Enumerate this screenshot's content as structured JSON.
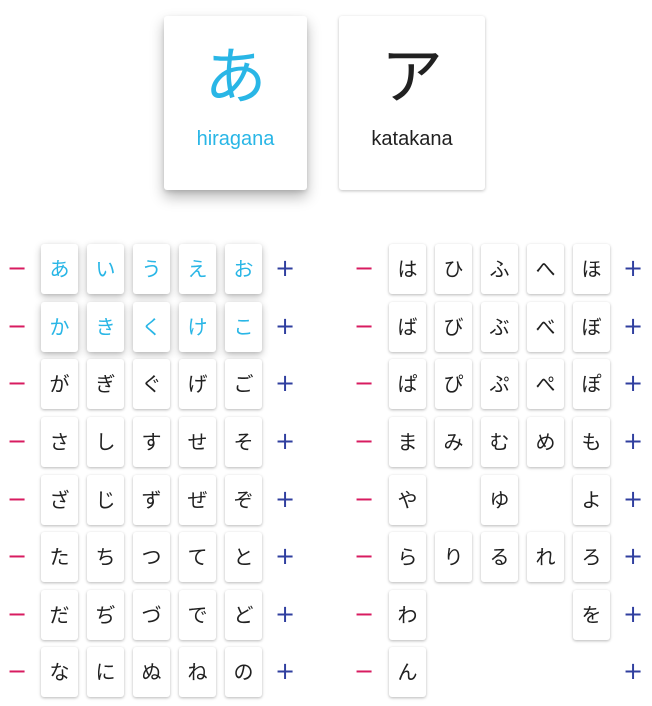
{
  "modes": {
    "hiragana": {
      "glyph": "あ",
      "label": "hiragana",
      "active": true
    },
    "katakana": {
      "glyph": "ア",
      "label": "katakana",
      "active": false
    }
  },
  "controls": {
    "remove": "−",
    "add": "+"
  },
  "colors": {
    "selected": "#29b6e6",
    "minus": "#d81b60",
    "plus": "#303f9f"
  },
  "left_rows": [
    {
      "chars": [
        "あ",
        "い",
        "う",
        "え",
        "お"
      ],
      "selected": true
    },
    {
      "chars": [
        "か",
        "き",
        "く",
        "け",
        "こ"
      ],
      "selected": true
    },
    {
      "chars": [
        "が",
        "ぎ",
        "ぐ",
        "げ",
        "ご"
      ],
      "selected": false
    },
    {
      "chars": [
        "さ",
        "し",
        "す",
        "せ",
        "そ"
      ],
      "selected": false
    },
    {
      "chars": [
        "ざ",
        "じ",
        "ず",
        "ぜ",
        "ぞ"
      ],
      "selected": false
    },
    {
      "chars": [
        "た",
        "ち",
        "つ",
        "て",
        "と"
      ],
      "selected": false
    },
    {
      "chars": [
        "だ",
        "ぢ",
        "づ",
        "で",
        "ど"
      ],
      "selected": false
    },
    {
      "chars": [
        "な",
        "に",
        "ぬ",
        "ね",
        "の"
      ],
      "selected": false
    }
  ],
  "right_rows": [
    {
      "chars": [
        "は",
        "ひ",
        "ふ",
        "へ",
        "ほ"
      ],
      "selected": false
    },
    {
      "chars": [
        "ば",
        "び",
        "ぶ",
        "べ",
        "ぼ"
      ],
      "selected": false
    },
    {
      "chars": [
        "ぱ",
        "ぴ",
        "ぷ",
        "ぺ",
        "ぽ"
      ],
      "selected": false
    },
    {
      "chars": [
        "ま",
        "み",
        "む",
        "め",
        "も"
      ],
      "selected": false
    },
    {
      "chars": [
        "や",
        "",
        "ゆ",
        "",
        "よ"
      ],
      "selected": false
    },
    {
      "chars": [
        "ら",
        "り",
        "る",
        "れ",
        "ろ"
      ],
      "selected": false
    },
    {
      "chars": [
        "わ",
        "",
        "",
        "",
        "を"
      ],
      "selected": false
    },
    {
      "chars": [
        "ん",
        "",
        "",
        "",
        ""
      ],
      "selected": false
    }
  ]
}
